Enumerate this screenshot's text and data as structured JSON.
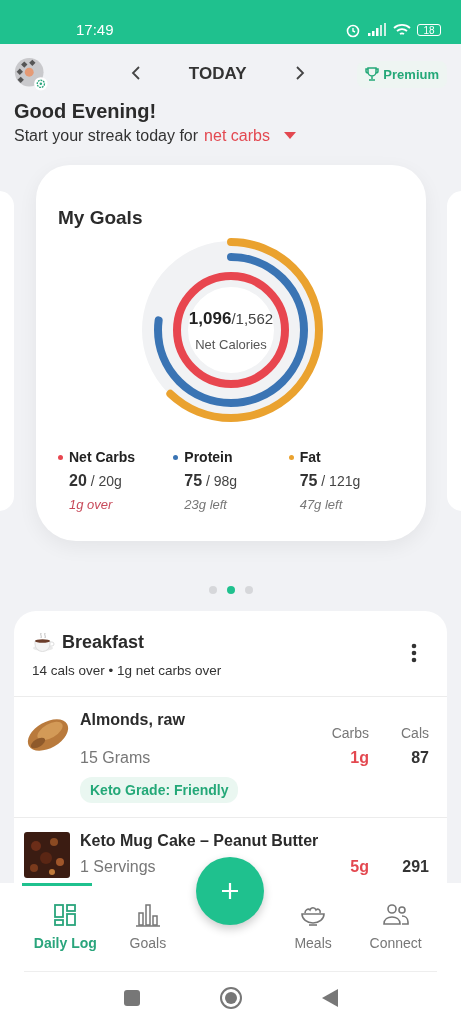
{
  "status_bar": {
    "time": "17:49",
    "battery": "18"
  },
  "header": {
    "title": "TODAY",
    "premium": "Premium",
    "greeting": "Good Evening!",
    "streak_text": "Start your streak today for",
    "streak_metric": "net carbs"
  },
  "goals": {
    "title": "My Goals",
    "center_value": "**1,096**/1,562",
    "center_label": "Net Calories",
    "rings": [
      {
        "color": "#e8464f",
        "level": 1
      },
      {
        "color": "#3a74b4",
        "level": 0.77
      },
      {
        "color": "#eaa22f",
        "level": 0.62
      }
    ],
    "macros": [
      {
        "name": "Net Carbs",
        "color": "#e8464f",
        "amount": "**20** / 20g",
        "status": "1g over",
        "over": true
      },
      {
        "name": "Protein",
        "color": "#3a74b4",
        "amount": "**75** / 98g",
        "status": "23g left",
        "over": false
      },
      {
        "name": "Fat",
        "color": "#eaa22f",
        "amount": "**75** / 121g",
        "status": "47g left",
        "over": false
      }
    ],
    "pager": [
      {
        "selected": false
      },
      {
        "selected": true
      },
      {
        "selected": false
      }
    ]
  },
  "meal": {
    "title": "Breakfast",
    "summary": "14 cals over • 1g net carbs over",
    "foods": [
      {
        "name": "Almonds, raw",
        "amount": "15 Grams",
        "carbs_label": "Carbs",
        "cals_label": "Cals",
        "carbs": "1g",
        "cals": "87",
        "grade": "Keto Grade: Friendly",
        "kind": "picture"
      },
      {
        "name": "Keto Mug Cake – Peanut Butter",
        "amount": "1 Servings",
        "carbs": "5g",
        "cals": "291",
        "kind": "picture"
      }
    ]
  },
  "nav": [
    {
      "label": "Daily Log",
      "kind": "log",
      "selected": true
    },
    {
      "label": "Goals",
      "kind": "chart",
      "selected": false
    },
    {
      "label": "Meals",
      "kind": "bowl",
      "selected": false
    },
    {
      "label": "Connect",
      "kind": "people",
      "selected": false
    }
  ]
}
